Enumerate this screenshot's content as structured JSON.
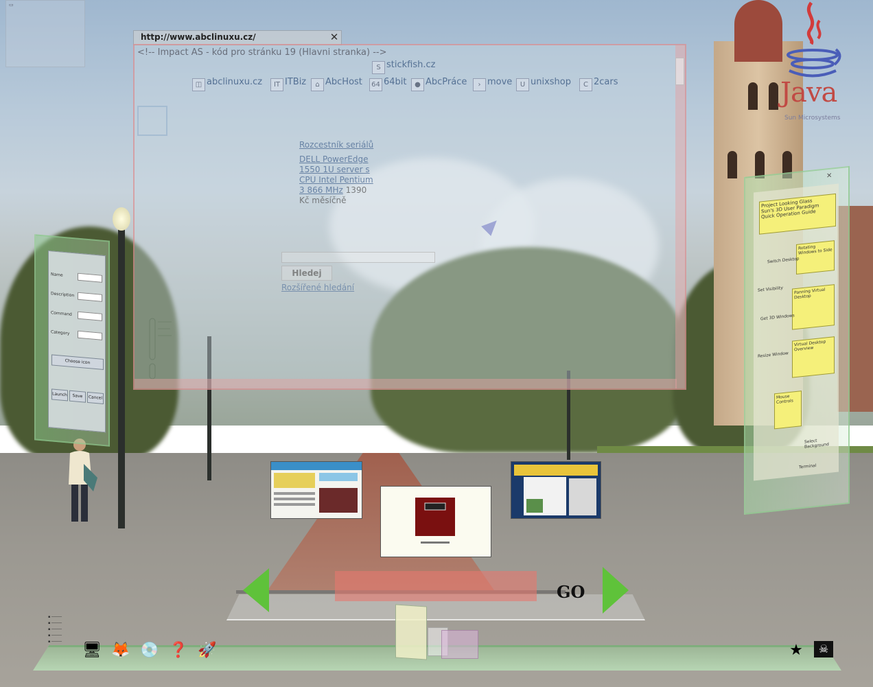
{
  "browser": {
    "url": "http://www.abclinuxu.cz/",
    "close_glyph": "✕",
    "comment": "<!-- Impact AS - kód pro stránku 19 (Hlavni stranka) -->",
    "top_bookmark": "stickfish.cz",
    "bookmarks": [
      "abclinuxu.cz",
      "ITBiz",
      "AbcHost",
      "64bit",
      "AbcPráce",
      "move",
      "unixshop",
      "2cars"
    ],
    "news": [
      {
        "link": "Rozcestník seriálů"
      },
      {
        "link": "DELL PowerEdge 1550 1U server s CPU Intel Pentium 3 866 MHz",
        "text": "1390 Kč měsíčně"
      }
    ],
    "search_button": "Hledej",
    "advanced_search": "Rozšířené hledání"
  },
  "java": {
    "word": "Java",
    "sub": "Sun Microsystems"
  },
  "left_dialog": {
    "rows": [
      "Name",
      "Description",
      "Command",
      "Category"
    ],
    "command_value": "",
    "buttons": [
      "Choose icon",
      "Launch",
      "Save",
      "Cancel"
    ]
  },
  "right_panel": {
    "title": "Project Looking Glass",
    "subtitle": "Sun's 3D User Paradigm Quick Operation Guide",
    "notes": [
      "Rotating Windows to Side",
      "Panning Virtual Desktop",
      "Virtual Desktop Overview",
      "Mouse Controls"
    ],
    "labels": [
      "Switch Desktop",
      "Set Visibility",
      "Get 3D Windows",
      "Resize Window",
      "Select Background",
      "Terminal"
    ]
  },
  "nav": {
    "go_label": "GO",
    "url_value": ""
  },
  "colors": {
    "accent_green": "#5fc23a",
    "url_field": "#e6786e",
    "java_red": "#c14a44"
  }
}
